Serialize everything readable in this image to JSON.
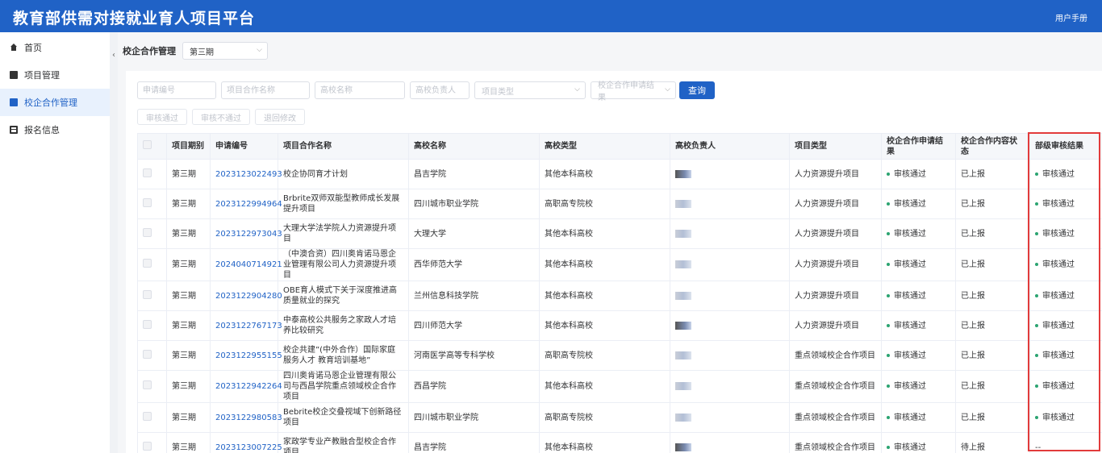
{
  "header": {
    "title": "教育部供需对接就业育人项目平台",
    "manual": "用户手册",
    "bg_color": "#2062c6"
  },
  "sidebar": {
    "items": [
      {
        "label": "首页",
        "icon": "home-icon"
      },
      {
        "label": "项目管理",
        "icon": "project-icon"
      },
      {
        "label": "校企合作管理",
        "icon": "book-icon",
        "active": true
      },
      {
        "label": "报名信息",
        "icon": "card-icon"
      }
    ]
  },
  "page": {
    "label": "校企合作管理",
    "period_select": "第三期"
  },
  "filters": {
    "app_no": "申请编号",
    "project_name": "项目合作名称",
    "school_name": "高校名称",
    "school_head": "高校负责人",
    "project_type": "项目类型",
    "coop_result": "校企合作申请结果",
    "query": "查询"
  },
  "actions": {
    "approve": "审核通过",
    "reject": "审核不通过",
    "return": "退回修改"
  },
  "table": {
    "headers": [
      "项目期别",
      "申请编号",
      "项目合作名称",
      "高校名称",
      "高校类型",
      "高校负责人",
      "项目类型",
      "校企合作申请结果",
      "校企合作内容状态",
      "部级审核结果"
    ],
    "rows": [
      {
        "period": "第三期",
        "no": "2023123022493",
        "name": "校企协同育才计划",
        "school": "昌吉学院",
        "type": "其他本科高校",
        "ptype": "人力资源提升项目",
        "result": "审核通过",
        "status": "已上报",
        "review": "审核通过"
      },
      {
        "period": "第三期",
        "no": "2023122994964",
        "name": "Brbrite双师双能型教师成长发展提升项目",
        "school": "四川城市职业学院",
        "type": "高职高专院校",
        "ptype": "人力资源提升项目",
        "result": "审核通过",
        "status": "已上报",
        "review": "审核通过"
      },
      {
        "period": "第三期",
        "no": "2023122973043",
        "name": "大理大学法学院人力资源提升项目",
        "school": "大理大学",
        "type": "其他本科高校",
        "ptype": "人力资源提升项目",
        "result": "审核通过",
        "status": "已上报",
        "review": "审核通过"
      },
      {
        "period": "第三期",
        "no": "2024040714921",
        "name": "（中澳合资）四川奥肯诺马恩企业管理有限公司人力资源提升项目",
        "school": "西华师范大学",
        "type": "其他本科高校",
        "ptype": "人力资源提升项目",
        "result": "审核通过",
        "status": "已上报",
        "review": "审核通过"
      },
      {
        "period": "第三期",
        "no": "2023122904280",
        "name": "OBE育人模式下关于深度推进高质量就业的探究",
        "school": "兰州信息科技学院",
        "type": "其他本科高校",
        "ptype": "人力资源提升项目",
        "result": "审核通过",
        "status": "已上报",
        "review": "审核通过"
      },
      {
        "period": "第三期",
        "no": "2023122767173",
        "name": "中泰高校公共服务之家政人才培养比较研究",
        "school": "四川师范大学",
        "type": "其他本科高校",
        "ptype": "人力资源提升项目",
        "result": "审核通过",
        "status": "已上报",
        "review": "审核通过"
      },
      {
        "period": "第三期",
        "no": "2023122955155",
        "name": "校企共建”(中外合作）国际家庭服务人才 教育培训基地”",
        "school": "河南医学高等专科学校",
        "type": "高职高专院校",
        "ptype": "重点领域校企合作项目",
        "result": "审核通过",
        "status": "已上报",
        "review": "审核通过"
      },
      {
        "period": "第三期",
        "no": "2023122942264",
        "name": "四川奥肯诺马恩企业管理有限公司与西昌学院重点领域校企合作项目",
        "school": "西昌学院",
        "type": "其他本科高校",
        "ptype": "重点领域校企合作项目",
        "result": "审核通过",
        "status": "已上报",
        "review": "审核通过"
      },
      {
        "period": "第三期",
        "no": "2023122980583",
        "name": "Bebrite校企交叠视域下创新路径项目",
        "school": "四川城市职业学院",
        "type": "高职高专院校",
        "ptype": "重点领域校企合作项目",
        "result": "审核通过",
        "status": "已上报",
        "review": "审核通过"
      },
      {
        "period": "第三期",
        "no": "2023123007225",
        "name": "家政学专业产教融合型校企合作项目",
        "school": "昌吉学院",
        "type": "其他本科高校",
        "ptype": "重点领域校企合作项目",
        "result": "审核通过",
        "status": "待上报",
        "review": "--"
      }
    ]
  },
  "accent": {
    "link": "#2062c6",
    "success_dot": "#2ba471",
    "highlight_border": "#e23b3b"
  }
}
